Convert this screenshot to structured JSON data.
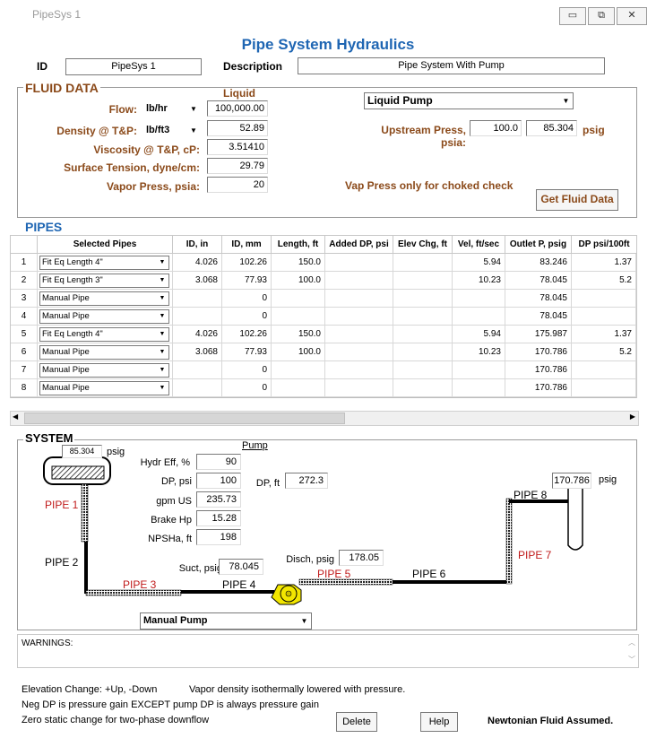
{
  "window": {
    "title": "PipeSys 1",
    "minimize": "▭",
    "restore": "⧉",
    "close": "✕"
  },
  "header": {
    "title": "Pipe System Hydraulics",
    "id_label": "ID",
    "id_value": "PipeSys 1",
    "desc_label": "Description",
    "desc_value": "Pipe System With Pump"
  },
  "fluid": {
    "group_title": "FLUID DATA",
    "column_title": "Liquid",
    "flow": {
      "label": "Flow:",
      "unit": "lb/hr",
      "value": "100,000.00"
    },
    "density": {
      "label": "Density @ T&P:",
      "unit": "lb/ft3",
      "value": "52.89"
    },
    "viscosity": {
      "label": "Viscosity @ T&P, cP:",
      "value": "3.51410"
    },
    "surface_tension": {
      "label": "Surface Tension, dyne/cm:",
      "value": "29.79"
    },
    "vapor_press": {
      "label": "Vapor Press, psia:",
      "value": "20"
    },
    "fluid_type": "Liquid Pump",
    "upstream": {
      "label": "Upstream Press, psia:",
      "psia": "100.0",
      "psig": "85.304",
      "unit": "psig"
    },
    "vap_note": "Vap Press only for choked check",
    "get_button": "Get Fluid Data"
  },
  "pipes": {
    "title": "PIPES",
    "columns": [
      "Selected Pipes",
      "ID, in",
      "ID, mm",
      "Length, ft",
      "Added DP, psi",
      "Elev Chg, ft",
      "Vel, ft/sec",
      "Outlet P, psig",
      "DP psi/100ft"
    ],
    "rows": [
      {
        "n": "1",
        "pipe": "Fit Eq Length 4\"",
        "id_in": "4.026",
        "id_mm": "102.26",
        "len": "150.0",
        "dp": "",
        "elev": "",
        "vel": "5.94",
        "out": "83.246",
        "dp100": "1.37"
      },
      {
        "n": "2",
        "pipe": "Fit Eq Length 3\"",
        "id_in": "3.068",
        "id_mm": "77.93",
        "len": "100.0",
        "dp": "",
        "elev": "",
        "vel": "10.23",
        "out": "78.045",
        "dp100": "5.2"
      },
      {
        "n": "3",
        "pipe": "Manual Pipe",
        "id_in": "",
        "id_mm": "0",
        "len": "",
        "dp": "",
        "elev": "",
        "vel": "",
        "out": "78.045",
        "dp100": ""
      },
      {
        "n": "4",
        "pipe": "Manual Pipe",
        "id_in": "",
        "id_mm": "0",
        "len": "",
        "dp": "",
        "elev": "",
        "vel": "",
        "out": "78.045",
        "dp100": ""
      },
      {
        "n": "5",
        "pipe": "Fit Eq Length 4\"",
        "id_in": "4.026",
        "id_mm": "102.26",
        "len": "150.0",
        "dp": "",
        "elev": "",
        "vel": "5.94",
        "out": "175.987",
        "dp100": "1.37"
      },
      {
        "n": "6",
        "pipe": "Manual Pipe",
        "id_in": "3.068",
        "id_mm": "77.93",
        "len": "100.0",
        "dp": "",
        "elev": "",
        "vel": "10.23",
        "out": "170.786",
        "dp100": "5.2"
      },
      {
        "n": "7",
        "pipe": "Manual Pipe",
        "id_in": "",
        "id_mm": "0",
        "len": "",
        "dp": "",
        "elev": "",
        "vel": "",
        "out": "170.786",
        "dp100": ""
      },
      {
        "n": "8",
        "pipe": "Manual Pipe",
        "id_in": "",
        "id_mm": "0",
        "len": "",
        "dp": "",
        "elev": "",
        "vel": "",
        "out": "170.786",
        "dp100": ""
      }
    ]
  },
  "system": {
    "title": "SYSTEM",
    "tank_press": "85.304",
    "psig": "psig",
    "pump_title": "Pump",
    "hydr_eff": {
      "label": "Hydr Eff, %",
      "value": "90"
    },
    "dp_psi": {
      "label": "DP, psi",
      "value": "100"
    },
    "dp_ft": {
      "label": "DP, ft",
      "value": "272.3"
    },
    "gpm": {
      "label": "gpm US",
      "value": "235.73"
    },
    "brake_hp": {
      "label": "Brake Hp",
      "value": "15.28"
    },
    "npsha": {
      "label": "NPSHa, ft",
      "value": "198"
    },
    "suct": {
      "label": "Suct, psig",
      "value": "78.045"
    },
    "disch": {
      "label": "Disch, psig",
      "value": "178.05"
    },
    "outlet_press": "170.786",
    "pipe_labels": [
      "PIPE 1",
      "PIPE 2",
      "PIPE 3",
      "PIPE 4",
      "PIPE 5",
      "PIPE 6",
      "PIPE 7",
      "PIPE 8"
    ],
    "pump_type": "Manual Pump"
  },
  "warnings": {
    "label": "WARNINGS:"
  },
  "notes": {
    "elev": "Elevation Change:  +Up, -Down",
    "vapor": "Vapor density isothermally lowered with pressure.",
    "neg": "Neg DP is pressure gain EXCEPT pump DP is always pressure gain",
    "zero": "Zero static change for two-phase downflow",
    "newtonian": "Newtonian Fluid Assumed."
  },
  "buttons": {
    "delete": "Delete",
    "help": "Help"
  },
  "colors": {
    "title_blue": "#1f66b3",
    "label_brown": "#8b4a1a",
    "pipe_red": "#c01a1a",
    "pump_yellow": "#f2e600"
  }
}
